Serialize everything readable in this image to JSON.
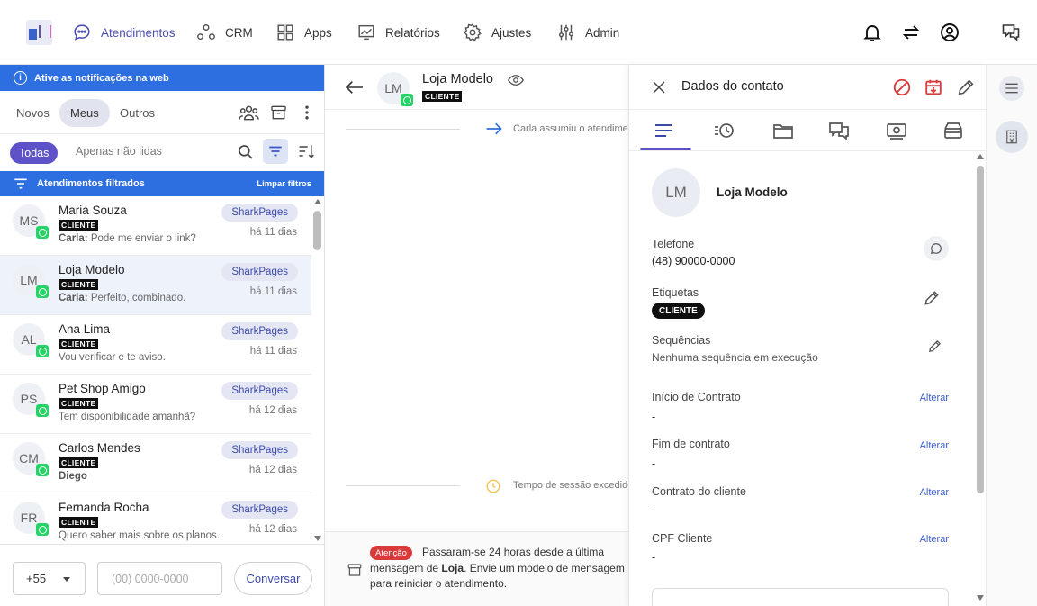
{
  "nav": {
    "items": [
      {
        "label": "Atendimentos",
        "icon": "chat-bubble-icon",
        "active": true
      },
      {
        "label": "CRM",
        "icon": "crm-nodes-icon"
      },
      {
        "label": "Apps",
        "icon": "grid-icon"
      },
      {
        "label": "Relatórios",
        "icon": "chart-icon"
      },
      {
        "label": "Ajustes",
        "icon": "gear-icon"
      },
      {
        "label": "Admin",
        "icon": "sliders-icon"
      }
    ]
  },
  "left": {
    "notif_text": "Ative as notificações na web",
    "tabs": [
      "Novos",
      "Meus",
      "Outros"
    ],
    "filter_all": "Todas",
    "filter_unread": "Apenas não lidas",
    "filtered_label": "Atendimentos filtrados",
    "clear_filters": "Limpar filtros",
    "conversations": [
      {
        "initials": "MS",
        "name": "Maria Souza",
        "badge": "CLIENTE",
        "sender": "Carla:",
        "message": "Pode me enviar o link?",
        "tag": "SharkPages",
        "time": "há 11 dias"
      },
      {
        "initials": "LM",
        "name": "Loja Modelo",
        "badge": "CLIENTE",
        "sender": "Carla:",
        "message": "Perfeito, combinado.",
        "tag": "SharkPages",
        "time": "há 11 dias",
        "selected": true
      },
      {
        "initials": "AL",
        "name": "Ana Lima",
        "badge": "CLIENTE",
        "sender": "",
        "message": "Vou verificar e te aviso.",
        "tag": "SharkPages",
        "time": "há 11 dias"
      },
      {
        "initials": "PS",
        "name": "Pet Shop Amigo",
        "badge": "CLIENTE",
        "sender": "",
        "message": "Tem disponibilidade amanhã?",
        "tag": "SharkPages",
        "time": "há 12 dias"
      },
      {
        "initials": "CM",
        "name": "Carlos Mendes",
        "badge": "CLIENTE",
        "sender": "Diego",
        "message": "",
        "tag": "SharkPages",
        "time": "há 12 dias"
      },
      {
        "initials": "FR",
        "name": "Fernanda Rocha",
        "badge": "CLIENTE",
        "sender": "",
        "message": "Quero saber mais sobre os planos.",
        "tag": "SharkPages",
        "time": "há 12 dias"
      }
    ],
    "ddi_value": "+55",
    "phone_placeholder": "(00) 0000-0000",
    "conversar_label": "Conversar"
  },
  "chat": {
    "avatar_initials": "LM",
    "title": "Loja Modelo",
    "badge": "CLIENTE",
    "system_msg_1": "Carla assumiu o atendimento",
    "system_msg_2": "Tempo de sessão excedido",
    "warning_badge": "Atenção",
    "warning_text_1": "Passaram-se 24 horas desde a última mensagem de ",
    "warning_name": "Loja",
    "warning_text_2": ". Envie um modelo de mensagem para reiniciar o atendimento."
  },
  "contact": {
    "title": "Dados do contato",
    "avatar_initials": "LM",
    "name": "Loja Modelo",
    "phone_label": "Telefone",
    "phone_value": "(48) 90000-0000",
    "tags_label": "Etiquetas",
    "tag_value": "CLIENTE",
    "sequences_label": "Sequências",
    "sequences_value": "Nenhuma sequência em execução",
    "fields": [
      {
        "label": "Início de Contrato",
        "value": "-",
        "action": "Alterar"
      },
      {
        "label": "Fim de contrato",
        "value": "-",
        "action": "Alterar"
      },
      {
        "label": "Contrato do cliente",
        "value": "-",
        "action": "Alterar"
      },
      {
        "label": "CPF Cliente",
        "value": "-",
        "action": "Alterar"
      }
    ]
  },
  "colors": {
    "accent": "#5d52c8",
    "blue_bar": "#2d6fe0",
    "whatsapp": "#25d366",
    "danger": "#d93a3a"
  }
}
